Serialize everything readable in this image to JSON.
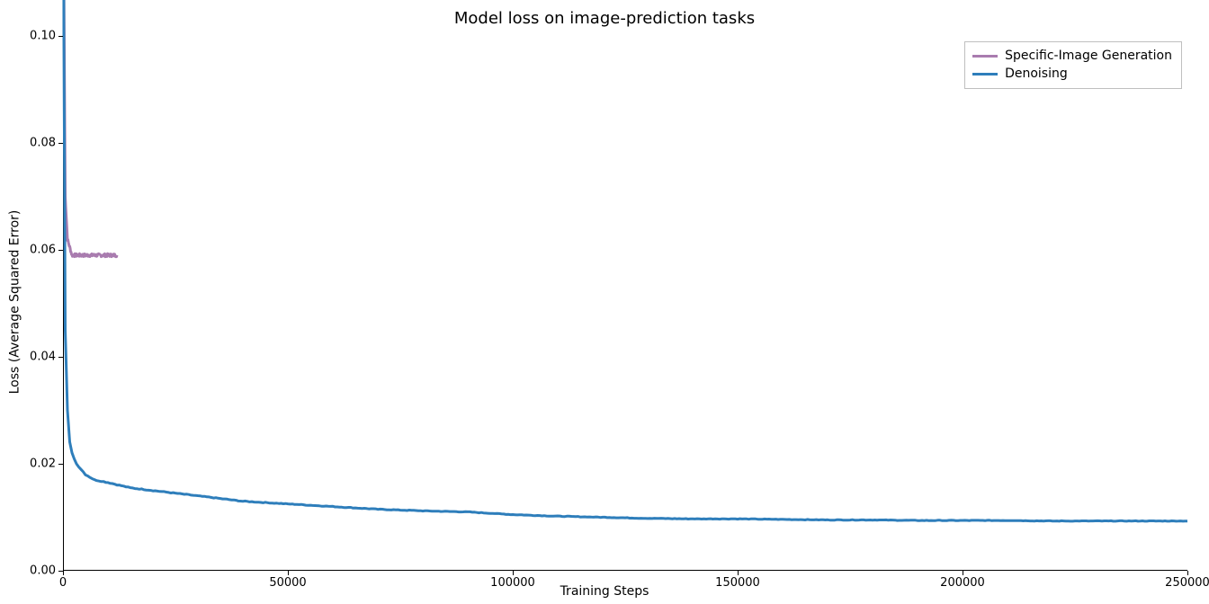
{
  "chart_data": {
    "type": "line",
    "title": "Model loss on image-prediction tasks",
    "xlabel": "Training Steps",
    "ylabel": "Loss (Average Squared Error)",
    "xlim": [
      0,
      250000
    ],
    "ylim": [
      0,
      0.1
    ],
    "xticks": [
      0,
      50000,
      100000,
      150000,
      200000,
      250000
    ],
    "yticks": [
      0.0,
      0.02,
      0.04,
      0.06,
      0.08,
      0.1
    ],
    "legend_position": "upper right",
    "series": [
      {
        "name": "Specific-Image Generation",
        "color": "#a97caf",
        "x": [
          0,
          200,
          500,
          1000,
          2000,
          3000,
          4000,
          5000,
          6000,
          7000,
          8000,
          9000,
          10000,
          11000,
          12000
        ],
        "y": [
          0.26,
          0.11,
          0.07,
          0.062,
          0.059,
          0.059,
          0.059,
          0.059,
          0.059,
          0.059,
          0.059,
          0.059,
          0.059,
          0.059,
          0.059
        ]
      },
      {
        "name": "Denoising",
        "color": "#2e7ebb",
        "x": [
          0,
          200,
          500,
          1000,
          1500,
          2000,
          3000,
          5000,
          7000,
          10000,
          15000,
          20000,
          30000,
          40000,
          50000,
          60000,
          70000,
          80000,
          90000,
          100000,
          110000,
          120000,
          130000,
          140000,
          150000,
          160000,
          170000,
          180000,
          190000,
          200000,
          210000,
          220000,
          230000,
          240000,
          250000
        ],
        "y": [
          0.26,
          0.1,
          0.045,
          0.03,
          0.024,
          0.022,
          0.02,
          0.018,
          0.017,
          0.0165,
          0.0155,
          0.015,
          0.014,
          0.013,
          0.0125,
          0.012,
          0.0115,
          0.0112,
          0.011,
          0.0105,
          0.0102,
          0.01,
          0.0098,
          0.0097,
          0.0097,
          0.0096,
          0.0095,
          0.0095,
          0.0094,
          0.0094,
          0.0094,
          0.0093,
          0.0093,
          0.0093,
          0.0093
        ]
      }
    ]
  }
}
